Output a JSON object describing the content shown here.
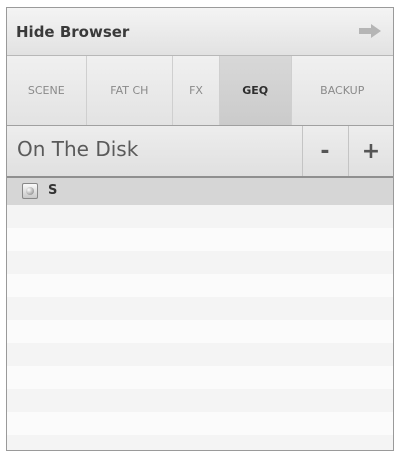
{
  "topbar": {
    "title": "Hide Browser",
    "icon": "arrow-right-icon"
  },
  "tabs": [
    {
      "label": "SCENE",
      "active": false
    },
    {
      "label": "FAT CH",
      "active": false
    },
    {
      "label": "FX",
      "active": false
    },
    {
      "label": "GEQ",
      "active": true
    },
    {
      "label": "BACKUP",
      "active": false
    }
  ],
  "disk": {
    "label": "On The Disk",
    "minus": "-",
    "plus": "+"
  },
  "list": {
    "items": [
      {
        "name": "S",
        "icon": "disk-icon"
      }
    ]
  },
  "colors": {
    "active_tab": "#cbcbcb",
    "header_row": "#d6d6d6",
    "border": "#9a9a9a"
  }
}
